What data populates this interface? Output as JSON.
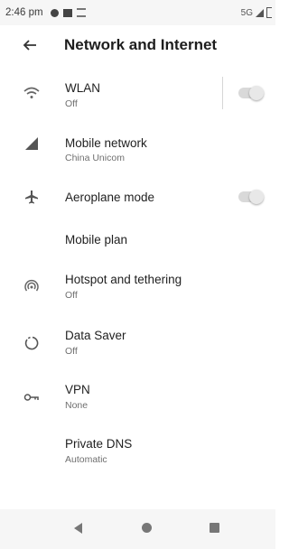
{
  "status_bar": {
    "time": "2:46 pm",
    "network": "5G"
  },
  "header": {
    "back_icon": "arrow-left-icon",
    "title": "Network and Internet"
  },
  "settings": [
    {
      "id": "wlan",
      "title": "WLAN",
      "subtitle": "Off",
      "icon": "wifi-icon",
      "toggle": false
    },
    {
      "id": "mobile-network",
      "title": "Mobile network",
      "subtitle": "China Unicom",
      "icon": "signal-icon"
    },
    {
      "id": "aeroplane-mode",
      "title": "Aeroplane mode",
      "icon": "airplane-icon",
      "toggle": false
    },
    {
      "id": "mobile-plan",
      "title": "Mobile plan"
    },
    {
      "id": "hotspot",
      "title": "Hotspot and tethering",
      "subtitle": "Off",
      "icon": "hotspot-icon"
    },
    {
      "id": "data-saver",
      "title": "Data Saver",
      "subtitle": "Off",
      "icon": "data-saver-icon"
    },
    {
      "id": "vpn",
      "title": "VPN",
      "subtitle": "None",
      "icon": "key-icon"
    },
    {
      "id": "private-dns",
      "title": "Private DNS",
      "subtitle": "Automatic"
    }
  ],
  "nav_bar": {
    "back": "nav-back-icon",
    "home": "nav-home-icon",
    "recents": "nav-recents-icon"
  }
}
